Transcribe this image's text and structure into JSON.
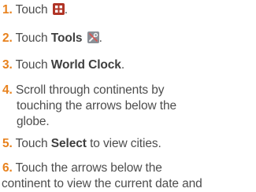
{
  "steps": [
    {
      "num": "1.",
      "text": "Touch",
      "icon": "apps-grid-icon",
      "end": "."
    },
    {
      "num": "2.",
      "pre": "Touch",
      "bold": "Tools",
      "icon": "tools-icon",
      "end": "."
    },
    {
      "num": "3.",
      "pre": "Touch",
      "bold": "World Clock",
      "end": "."
    },
    {
      "num": "4.",
      "lines": [
        "Scroll through continents by",
        "touching the arrows below the",
        "globe."
      ]
    },
    {
      "num": "5.",
      "pre": "Touch",
      "bold": "Select",
      "post": "to view cities."
    },
    {
      "num": "6.",
      "lines": [
        "Touch the arrows below the",
        "continent to view the current date and"
      ]
    }
  ],
  "colors": {
    "number": "#e8821e",
    "text": "#4d4d4d",
    "icon_bg": "#c0392b"
  }
}
